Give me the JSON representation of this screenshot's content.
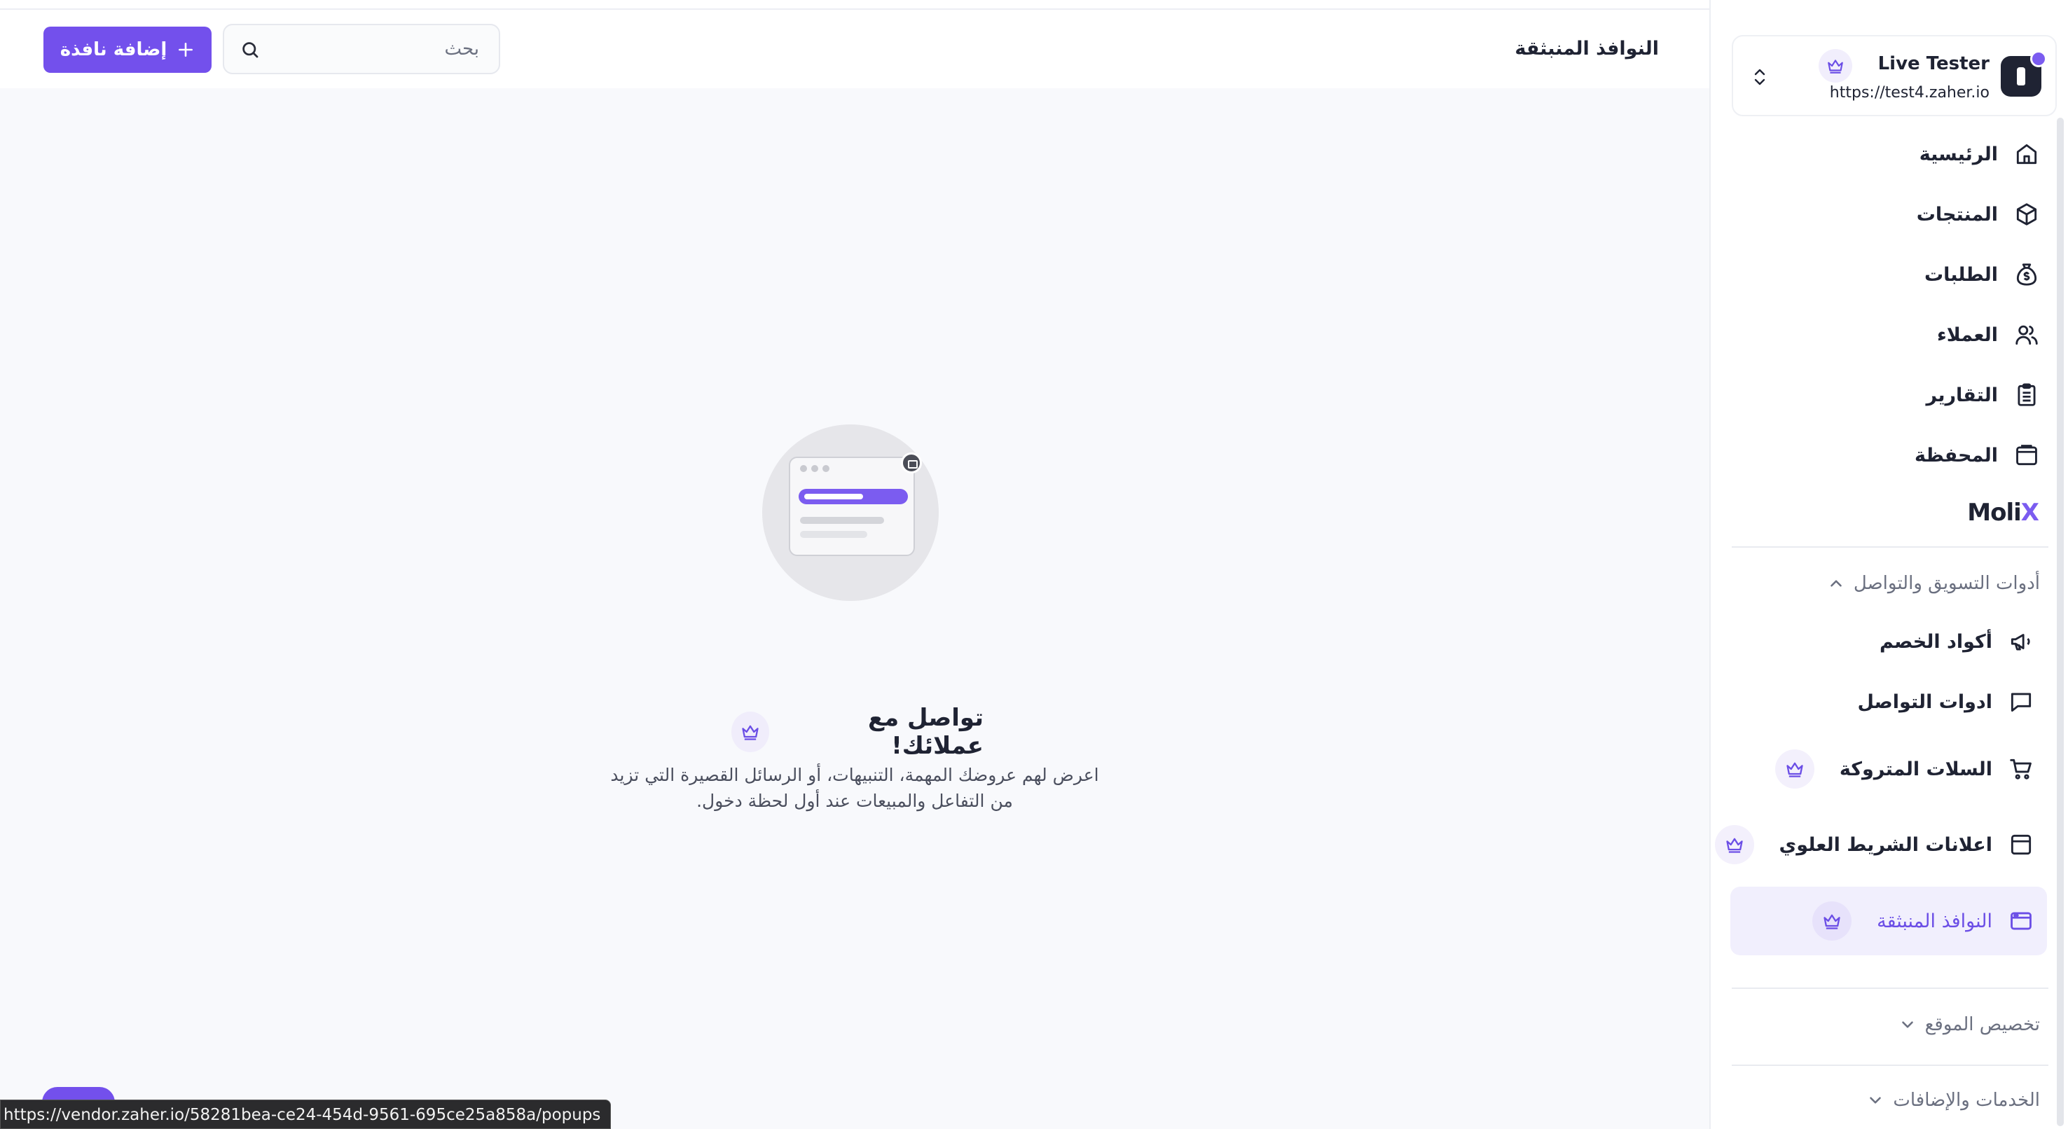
{
  "header": {
    "page_title": "النوافذ المنبثقة",
    "search_placeholder": "بحث",
    "add_button_label": "إضافة نافذة"
  },
  "store": {
    "name": "Live Tester",
    "url": "https://test4.zaher.io"
  },
  "sidebar": {
    "nav_items": [
      {
        "label": "الرئيسية",
        "icon": "home-icon"
      },
      {
        "label": "المنتجات",
        "icon": "box-icon"
      },
      {
        "label": "الطلبات",
        "icon": "money-bag-icon"
      },
      {
        "label": "العملاء",
        "icon": "users-icon"
      },
      {
        "label": "التقارير",
        "icon": "clipboard-icon"
      },
      {
        "label": "المحفظة",
        "icon": "wallet-icon"
      }
    ],
    "brand": "MoliX",
    "marketing_section": {
      "title": "أدوات التسويق والتواصل",
      "items": [
        {
          "label": "أكواد الخصم",
          "icon": "megaphone-icon",
          "premium": false
        },
        {
          "label": "ادوات التواصل",
          "icon": "chat-bubble-icon",
          "premium": false
        },
        {
          "label": "السلات المتروكة",
          "icon": "cart-icon",
          "premium": true
        },
        {
          "label": "اعلانات الشريط العلوي",
          "icon": "top-bar-icon",
          "premium": true
        },
        {
          "label": "النوافذ المنبثقة",
          "icon": "popup-window-icon",
          "premium": true,
          "active": true
        }
      ]
    },
    "site_section_title": "تخصيص الموقع",
    "services_section_title": "الخدمات والإضافات"
  },
  "empty_state": {
    "title": "تواصل مع عملائك!",
    "description": "اعرض لهم عروضك المهمة، التنبيهات، أو الرسائل القصيرة التي تزيد من التفاعل والمبيعات عند أول لحظة دخول."
  },
  "status_bar": {
    "url": "https://vendor.zaher.io/58281bea-ce24-454d-9561-695ce25a858a/popups"
  },
  "colors": {
    "accent": "#7350ec",
    "active_bg": "#f1effd",
    "content_bg": "#f8f9fc",
    "text": "#1f2333"
  }
}
